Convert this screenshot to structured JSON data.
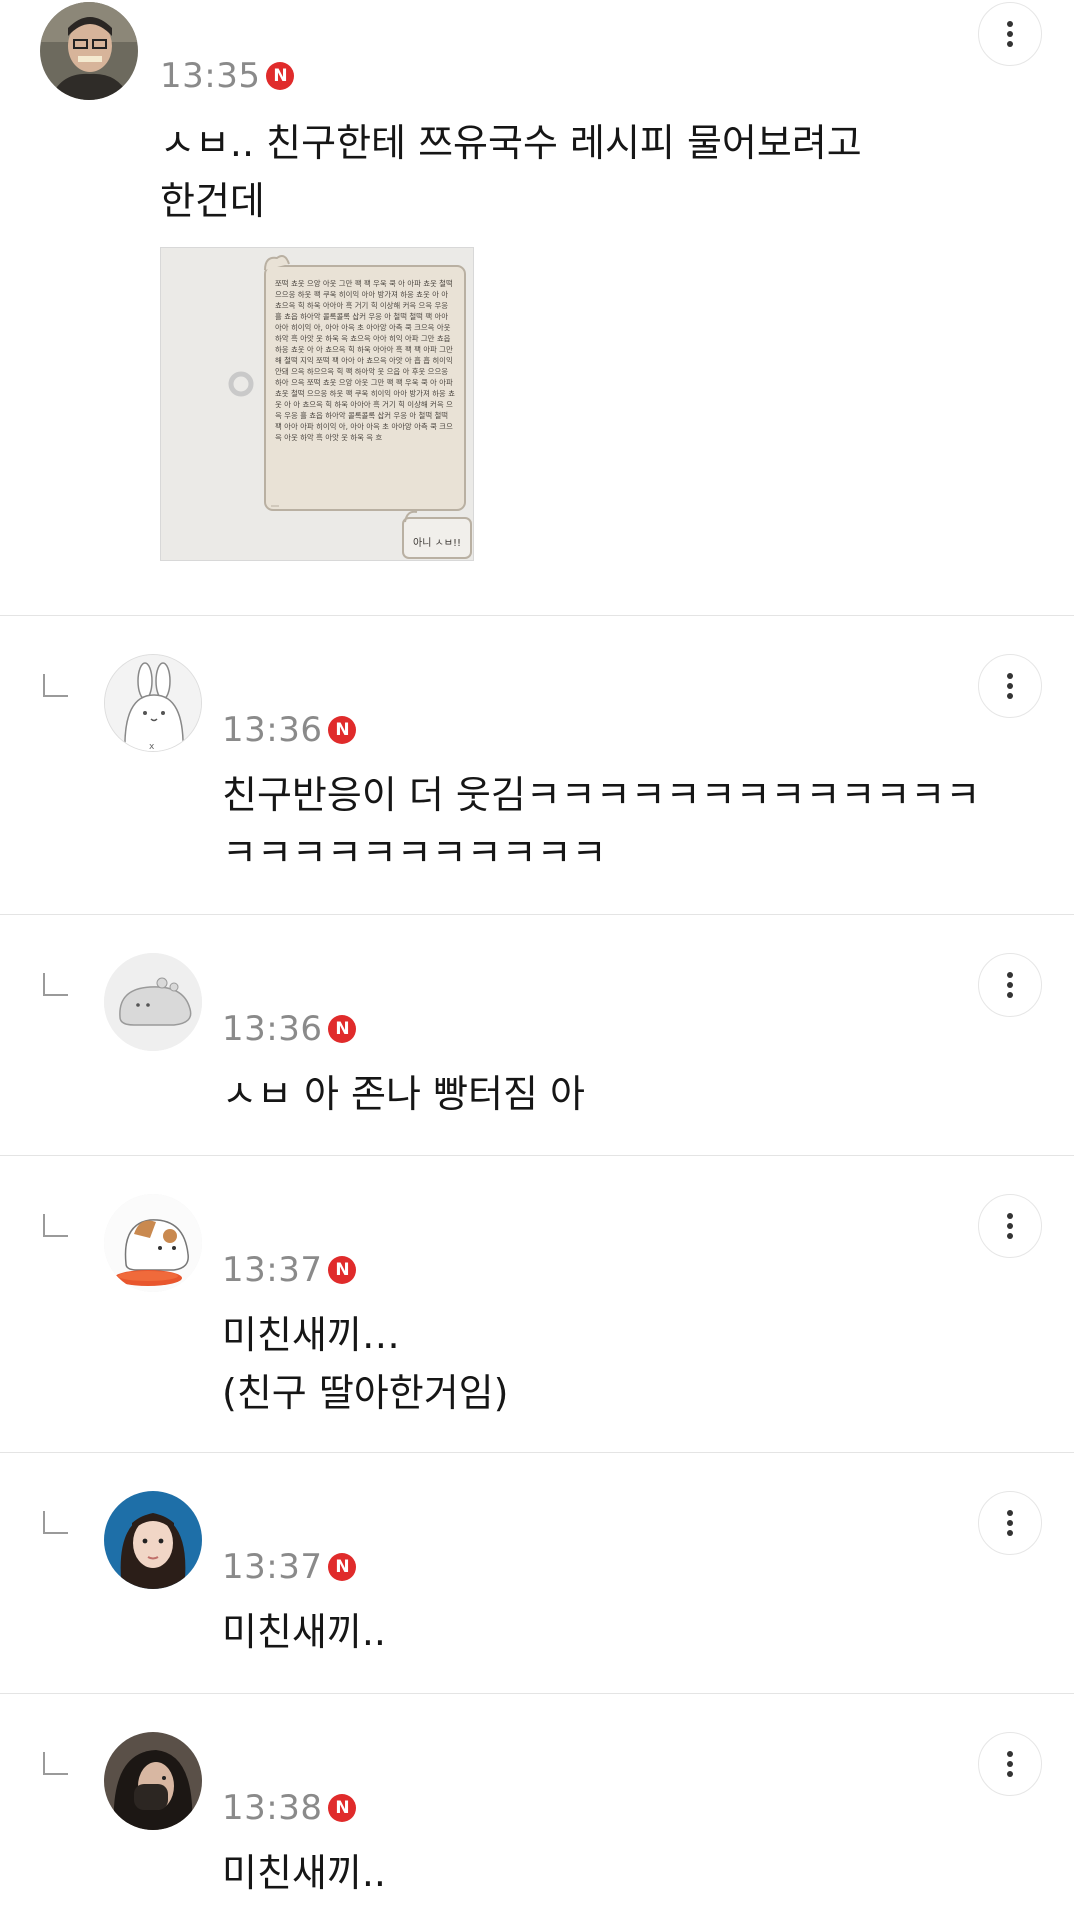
{
  "comments": [
    {
      "time": "13:35",
      "badge": "N",
      "text": "ㅅㅂ.. 친구한테 쯔유국수 레시피 물어보려고\n한건데",
      "avatar": "man-eating-avatar",
      "attachment": {
        "bubble_text": "쪼떡 쵸웃 으앙 아웃 그만 팩 팩 우욱 쿡 아 아파 쵸웃 철떡 으으응 하웃 팩 쿠욱 히이익 아아 방가져 하응 쵸웃 아 아 쵸으윽 힉 하욱 아아아 흑 거기 힉 이상해 커윽 으윽 우응 흘 쵸읍 하아악 콜록콜록 삽커 우응 아 철떡 철떡 팩 아아 아아 히이익 아, 아아 아윽 초 아아앙 아측 쿡 크으윽 아웃 하악 흑 아앗 웃 하욱 윽 쵸으윽 아아 히익 아파 그만 쵸읍 하응 쵸웃 아 아 쵸으윽 힉 하욱 아아아 흑 팩 팩 아파 그만해 철떡 지익 쪼떡 팩 아아 아 쵸으윽 아앗 아 흡 흡 히이익 안돼 으윽 하으으윽 힉 팩 하아악 웃 으읍 아 후웃 으으응 하아 으윽 쪼떡 쵸웃 으앙 아웃 그만 팩 팩 우욱 쿡 아 아파 쵸웃 철떡 으으응 하웃 팩 쿠욱 히이익 아아 방가져 하응 쵸웃 아 아 쵸으윽 힉 하욱 아아아 흑 거기 힉 이상해 커윽 으윽 우응 흘 쵸읍 하아악 콜록콜록 삽커 우응 아 철떡 철떡 팩 아아 아파 히이익 아, 아아 아윽 초 아아앙 아측 쿡 크으윽 아웃 하악 흑 아앗 웃 하욱 윽 흐",
        "reply_text": "아니 ㅅㅂ!!"
      }
    },
    {
      "time": "13:36",
      "badge": "N",
      "text": "친구반응이 더 웃김ㅋㅋㅋㅋㅋㅋㅋㅋㅋㅋㅋㅋㅋ\nㅋㅋㅋㅋㅋㅋㅋㅋㅋㅋㅋ",
      "avatar": "white-rabbit-avatar"
    },
    {
      "time": "13:36",
      "badge": "N",
      "text": "ㅅㅂ 아 존나 빵터짐 아",
      "avatar": "grey-creature-avatar"
    },
    {
      "time": "13:37",
      "badge": "N",
      "text": "미친새끼…\n(친구 딸아한거임)",
      "avatar": "calico-cat-avatar"
    },
    {
      "time": "13:37",
      "badge": "N",
      "text": "미친새끼..",
      "avatar": "girl-photo-avatar"
    },
    {
      "time": "13:38",
      "badge": "N",
      "text": "미친새끼..",
      "avatar": "woman-photo-avatar"
    }
  ],
  "colors": {
    "badge": "#e02b2b",
    "time": "#8a8a8a",
    "divider": "#e4e4e4",
    "text": "#161616"
  },
  "icons": {
    "more": "more-vertical-icon",
    "reply": "reply-arrow-icon"
  }
}
